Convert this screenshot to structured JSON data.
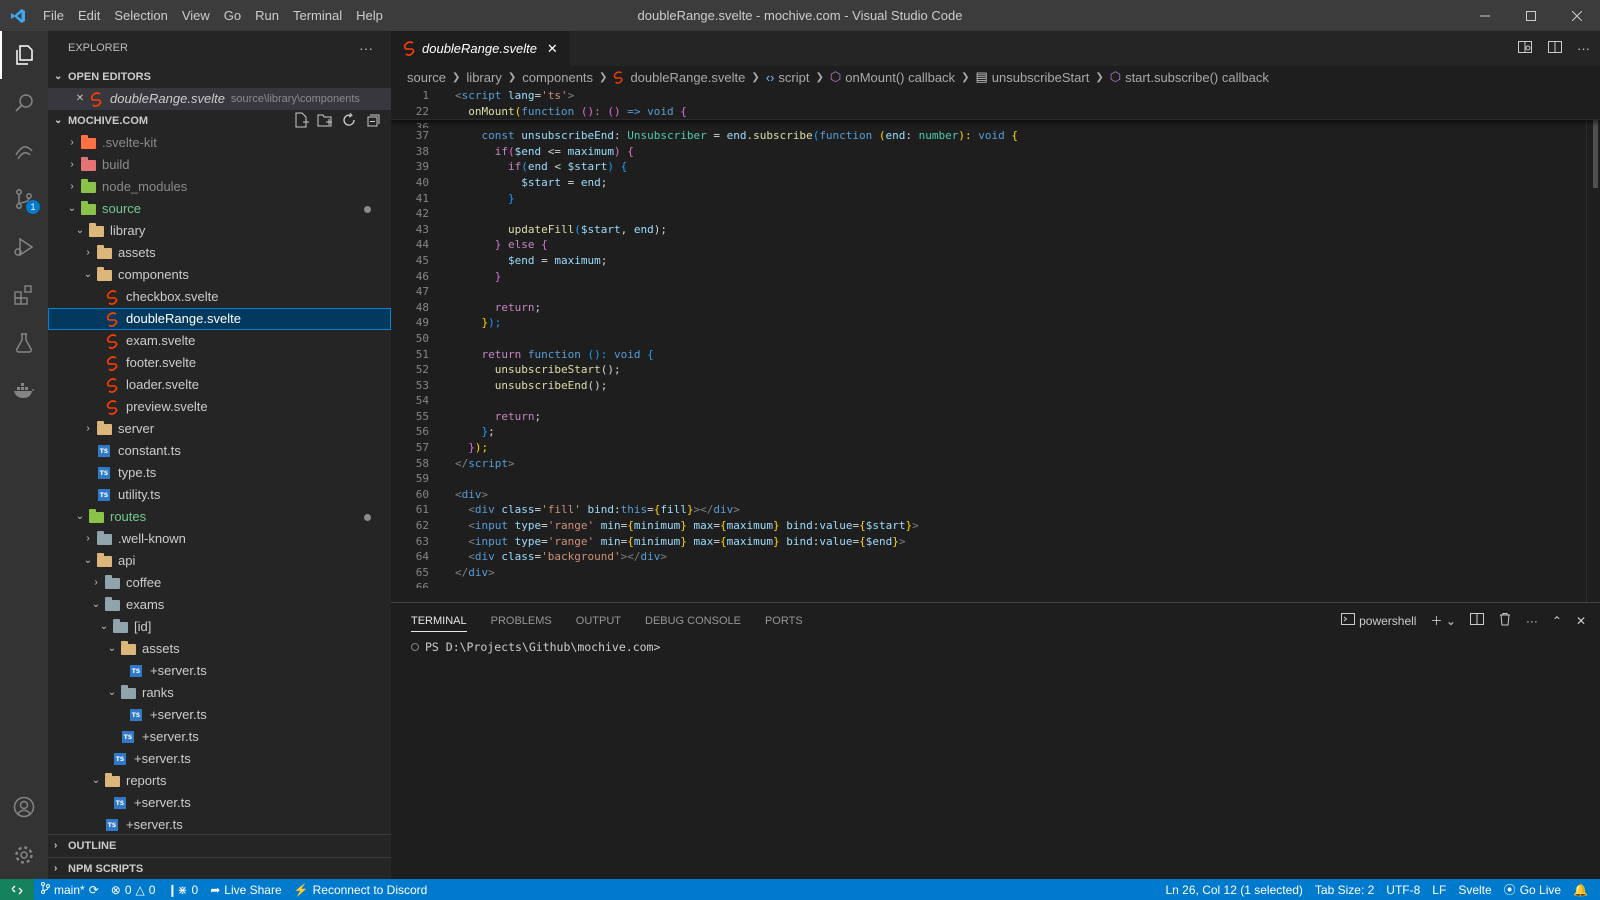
{
  "window": {
    "title": "doubleRange.svelte - mochive.com - Visual Studio Code",
    "menu": [
      "File",
      "Edit",
      "Selection",
      "View",
      "Go",
      "Run",
      "Terminal",
      "Help"
    ]
  },
  "activity": {
    "scm_badge": "1"
  },
  "explorer": {
    "header": "EXPLORER",
    "open_editors_title": "OPEN EDITORS",
    "open_editor": {
      "name": "doubleRange.svelte",
      "path": "source\\library\\components"
    },
    "workspace_title": "MOCHIVE.COM",
    "tree": [
      {
        "label": ".svelte-kit",
        "dim": true
      },
      {
        "label": "build"
      },
      {
        "label": "node_modules"
      },
      {
        "label": "source"
      },
      {
        "label": "library"
      },
      {
        "label": "assets"
      },
      {
        "label": "components"
      },
      {
        "label": "checkbox.svelte"
      },
      {
        "label": "doubleRange.svelte"
      },
      {
        "label": "exam.svelte"
      },
      {
        "label": "footer.svelte"
      },
      {
        "label": "loader.svelte"
      },
      {
        "label": "preview.svelte"
      },
      {
        "label": "server"
      },
      {
        "label": "constant.ts"
      },
      {
        "label": "type.ts"
      },
      {
        "label": "utility.ts"
      },
      {
        "label": "routes"
      },
      {
        "label": ".well-known"
      },
      {
        "label": "api"
      },
      {
        "label": "coffee"
      },
      {
        "label": "exams"
      },
      {
        "label": "[id]"
      },
      {
        "label": "assets"
      },
      {
        "label": "+server.ts"
      },
      {
        "label": "ranks"
      },
      {
        "label": "+server.ts"
      },
      {
        "label": "+server.ts"
      },
      {
        "label": "+server.ts"
      },
      {
        "label": "reports"
      },
      {
        "label": "+server.ts"
      },
      {
        "label": "+server.ts"
      }
    ],
    "outline_title": "OUTLINE",
    "npm_title": "NPM SCRIPTS",
    "ts_badge": "TS"
  },
  "editor": {
    "tab_label": "doubleRange.svelte",
    "breadcrumbs": [
      "source",
      "library",
      "components",
      "doubleRange.svelte",
      "script",
      "onMount() callback",
      "unsubscribeStart",
      "start.subscribe() callback"
    ],
    "line_numbers": [
      "1",
      "22",
      "36",
      "37",
      "38",
      "39",
      "40",
      "41",
      "42",
      "43",
      "44",
      "45",
      "46",
      "47",
      "48",
      "49",
      "50",
      "51",
      "52",
      "53",
      "54",
      "55",
      "56",
      "57",
      "58",
      "59",
      "60",
      "61",
      "62",
      "63",
      "64",
      "65",
      "66"
    ],
    "code": {
      "l1": [
        "<",
        "script",
        " ",
        "lang",
        "=",
        "'ts'",
        ">"
      ],
      "l22": [
        "onMount",
        "(",
        "function",
        " (): () ",
        "=>",
        " void ",
        "{"
      ],
      "l37": [
        "const",
        " unsubscribeEnd",
        ": ",
        "Unsubscriber",
        " = ",
        "end",
        ".",
        "subscribe",
        "(",
        "function",
        " (",
        "end",
        ": ",
        "number",
        "): ",
        "void",
        " ",
        "{"
      ],
      "l38": [
        "if",
        "(",
        "$end",
        " <= ",
        "maximum",
        ") ",
        "{"
      ],
      "l39": [
        "if",
        "(",
        "end",
        " < ",
        "$start",
        ") ",
        "{"
      ],
      "l40": [
        "$start",
        " = ",
        "end",
        ";"
      ],
      "l41": [
        "}"
      ],
      "l43": [
        "updateFill",
        "(",
        "$start",
        ", ",
        "end",
        ");"
      ],
      "l44": [
        "} ",
        "else",
        " ",
        "{"
      ],
      "l45": [
        "$end",
        " = ",
        "maximum",
        ";"
      ],
      "l46": [
        "}"
      ],
      "l48": [
        "return",
        ";"
      ],
      "l49": [
        "}",
        ");"
      ],
      "l51": [
        "return",
        " ",
        "function",
        " (): ",
        "void",
        " ",
        "{"
      ],
      "l52": [
        "unsubscribeStart",
        "();"
      ],
      "l53": [
        "unsubscribeEnd",
        "();"
      ],
      "l55": [
        "return",
        ";"
      ],
      "l56": [
        "}",
        ";"
      ],
      "l57": [
        "}",
        ");"
      ],
      "l58": [
        "</",
        "script",
        ">"
      ],
      "l60": [
        "<",
        "div",
        ">"
      ],
      "l61": [
        "<",
        "div",
        " ",
        "class",
        "=",
        "'fill'",
        " ",
        "bind",
        ":",
        "this",
        "=",
        "{",
        "fill",
        "}",
        "></",
        "div",
        ">"
      ],
      "l62": [
        "<",
        "input",
        " ",
        "type",
        "=",
        "'range'",
        " ",
        "min",
        "=",
        "{",
        "minimum",
        "}",
        " ",
        "max",
        "=",
        "{",
        "maximum",
        "}",
        " ",
        "bind",
        ":",
        "value",
        "=",
        "{",
        "$start",
        "}",
        ">"
      ],
      "l63": [
        "<",
        "input",
        " ",
        "type",
        "=",
        "'range'",
        " ",
        "min",
        "=",
        "{",
        "minimum",
        "}",
        " ",
        "max",
        "=",
        "{",
        "maximum",
        "}",
        " ",
        "bind",
        ":",
        "value",
        "=",
        "{",
        "$end",
        "}",
        ">"
      ],
      "l64": [
        "<",
        "div",
        " ",
        "class",
        "=",
        "'background'",
        "></",
        "div",
        ">"
      ],
      "l65": [
        "</",
        "div",
        ">"
      ]
    }
  },
  "panel": {
    "tabs": [
      "TERMINAL",
      "PROBLEMS",
      "OUTPUT",
      "DEBUG CONSOLE",
      "PORTS"
    ],
    "shell": "powershell",
    "prompt": "PS D:\\Projects\\Github\\mochive.com>"
  },
  "status": {
    "branch": "main*",
    "errors": "0",
    "warnings": "0",
    "ports": "0",
    "live_share": "Live Share",
    "discord": "Reconnect to Discord",
    "cursor": "Ln 26, Col 12 (1 selected)",
    "tab_size": "Tab Size: 2",
    "encoding": "UTF-8",
    "eol": "LF",
    "language": "Svelte",
    "go_live": "Go Live"
  },
  "colors": {
    "accent": "#007acc",
    "remote": "#16825d",
    "selection": "#04395e"
  }
}
